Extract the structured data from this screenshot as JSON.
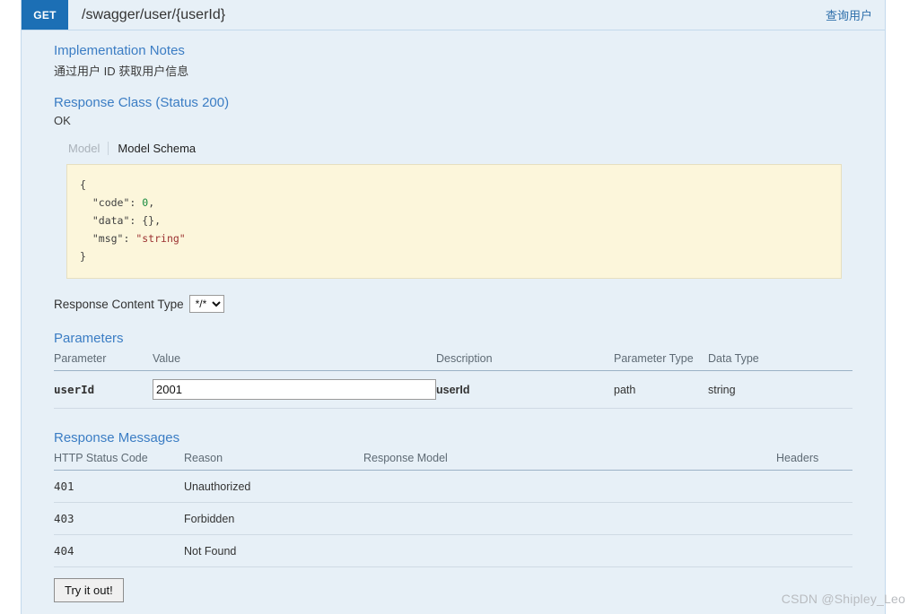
{
  "operation": {
    "method": "GET",
    "path": "/swagger/user/{userId}",
    "summary": "查询用户"
  },
  "implementation_notes": {
    "heading": "Implementation Notes",
    "text": "通过用户 ID 获取用户信息"
  },
  "response_class": {
    "heading": "Response Class (Status 200)",
    "status_text": "OK",
    "tabs": {
      "model": "Model",
      "model_schema": "Model Schema"
    },
    "schema": {
      "open_brace": "{",
      "close_brace": "}",
      "lines": [
        {
          "key": "\"code\"",
          "sep": ": ",
          "value": "0",
          "value_type": "num",
          "comma": ","
        },
        {
          "key": "\"data\"",
          "sep": ": ",
          "value": "{}",
          "value_type": "punc",
          "comma": ","
        },
        {
          "key": "\"msg\"",
          "sep": ": ",
          "value": "\"string\"",
          "value_type": "str",
          "comma": ""
        }
      ]
    }
  },
  "response_content_type": {
    "label": "Response Content Type",
    "selected": "*/*",
    "options": [
      "*/*"
    ]
  },
  "parameters": {
    "heading": "Parameters",
    "columns": [
      "Parameter",
      "Value",
      "Description",
      "Parameter Type",
      "Data Type"
    ],
    "rows": [
      {
        "parameter": "userId",
        "value": "2001",
        "placeholder": "",
        "description": "userId",
        "parameter_type": "path",
        "data_type": "string"
      }
    ]
  },
  "response_messages": {
    "heading": "Response Messages",
    "columns": [
      "HTTP Status Code",
      "Reason",
      "Response Model",
      "Headers"
    ],
    "rows": [
      {
        "code": "401",
        "reason": "Unauthorized",
        "model": "",
        "headers": ""
      },
      {
        "code": "403",
        "reason": "Forbidden",
        "model": "",
        "headers": ""
      },
      {
        "code": "404",
        "reason": "Not Found",
        "model": "",
        "headers": ""
      }
    ]
  },
  "actions": {
    "try_it_out": "Try it out!"
  },
  "watermark": "CSDN @Shipley_Leo",
  "colors": {
    "method_badge": "#1c6fb5",
    "panel_background": "#e7f0f7",
    "panel_border": "#c3d9ec",
    "heading_link": "#3b7dc4",
    "schema_background": "#fcf6db",
    "schema_border": "#e6dfc0",
    "json_number": "#158a3d",
    "json_string": "#9b3030"
  }
}
